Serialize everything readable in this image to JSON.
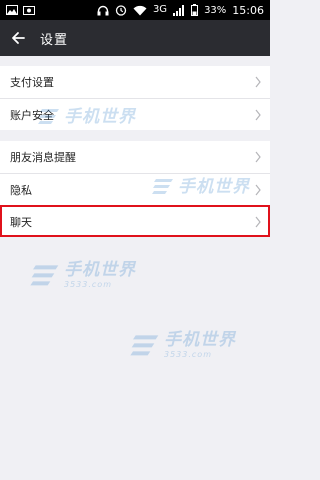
{
  "status_bar": {
    "signal_label": "3G",
    "battery_percent": "33%",
    "time": "15:06"
  },
  "app_bar": {
    "title": "设置"
  },
  "groups": [
    {
      "items": [
        {
          "label": "支付设置"
        },
        {
          "label": "账户安全"
        }
      ]
    },
    {
      "items": [
        {
          "label": "朋友消息提醒"
        },
        {
          "label": "隐私"
        },
        {
          "label": "聊天",
          "highlighted": true
        }
      ]
    }
  ],
  "watermark": {
    "text_cn": "手机世界",
    "text_en": "3533.com"
  },
  "colors": {
    "app_bar": "#2b2c31",
    "background": "#f0f0f4",
    "highlight_border": "#e0111b",
    "watermark": "#4a8fcf"
  },
  "icons": [
    "image-icon",
    "photo-icon",
    "headphones-icon",
    "alarm-icon",
    "wifi-icon",
    "signal-icon",
    "battery-icon",
    "back-arrow-icon",
    "chevron-right-icon"
  ]
}
